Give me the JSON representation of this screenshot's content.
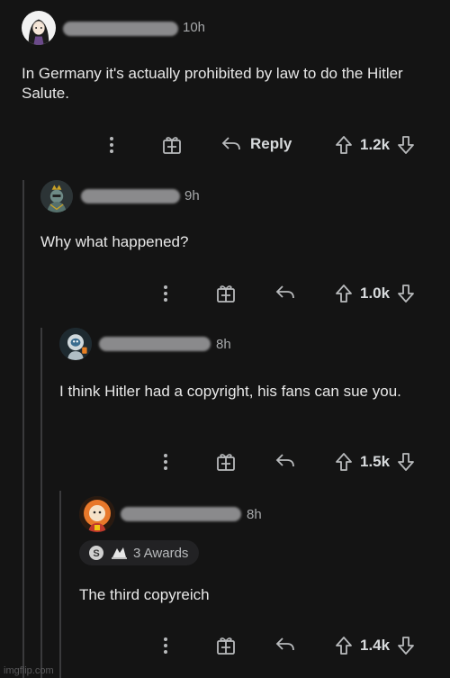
{
  "comments": [
    {
      "time": "10h",
      "body": "In Germany it's actually prohibited by law to do the Hitler Salute.",
      "reply_label": "Reply",
      "votes": "1.2k",
      "avatar": "avatar-woman-dark-hair"
    },
    {
      "time": "9h",
      "body": "Why what happened?",
      "votes": "1.0k",
      "avatar": "avatar-crowned-knight"
    },
    {
      "time": "8h",
      "body": "I think Hitler had a copyright, his fans can sue you.",
      "votes": "1.5k",
      "avatar": "avatar-astronaut-snoo"
    },
    {
      "time": "8h",
      "body": "The third copyreich",
      "awards_label": "3 Awards",
      "votes": "1.4k",
      "avatar": "avatar-lion-mane"
    }
  ],
  "icons": {
    "more": "more-vertical-icon",
    "award": "gift-award-icon",
    "reply": "reply-arrow-icon",
    "upvote": "upvote-arrow-icon",
    "downvote": "downvote-arrow-icon"
  },
  "watermark": "imgflip.com",
  "colors": {
    "background": "#141414",
    "text": "#d7dadc",
    "muted": "#a7a9ab",
    "thread_line": "#3a3a3c"
  }
}
